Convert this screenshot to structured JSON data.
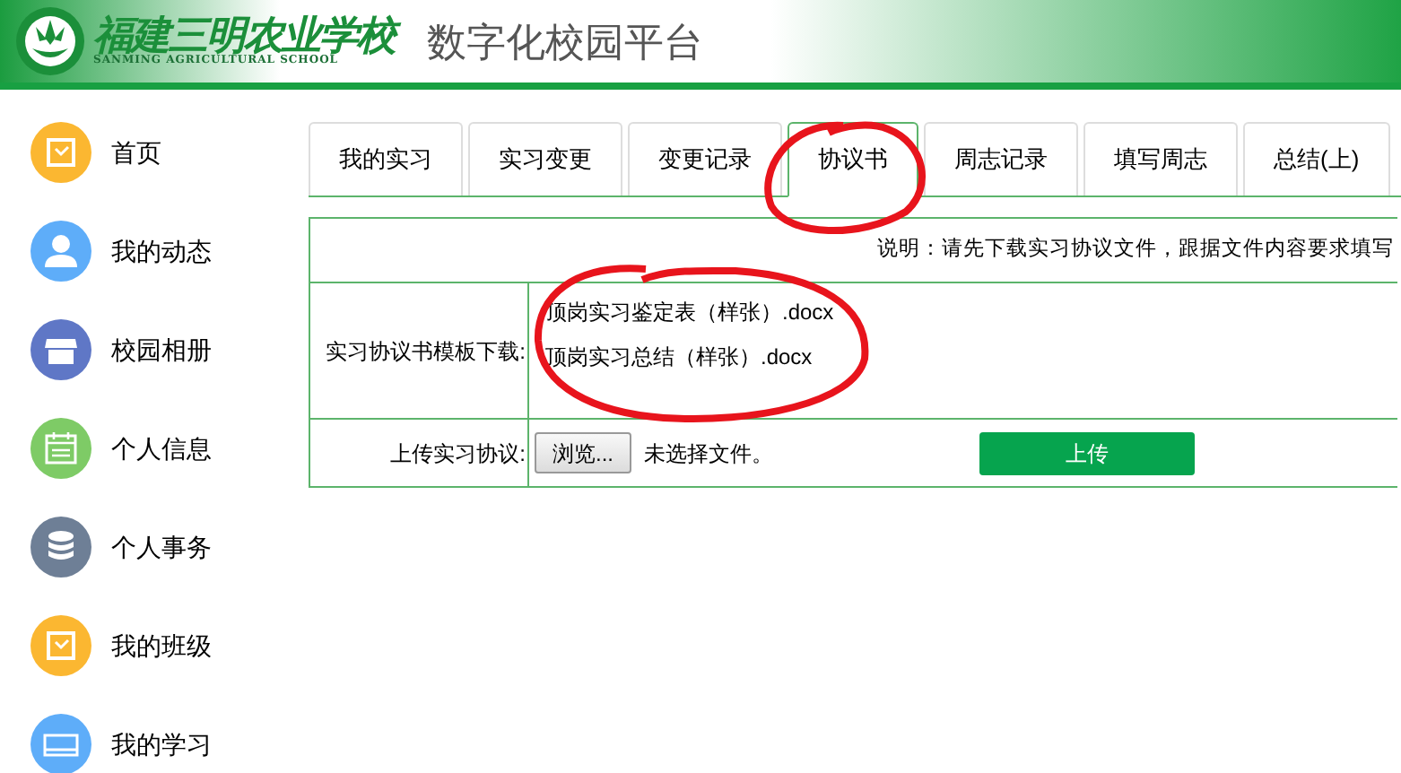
{
  "header": {
    "school_name": "福建三明农业学校",
    "school_name_en": "SANMING AGRICULTURAL SCHOOL",
    "platform_title": "数字化校园平台"
  },
  "sidebar": {
    "items": [
      {
        "label": "首页",
        "kind": "checkbox",
        "color": "#fbb731"
      },
      {
        "label": "我的动态",
        "kind": "person",
        "color": "#5eadf9"
      },
      {
        "label": "校园相册",
        "kind": "store",
        "color": "#5f77c6"
      },
      {
        "label": "个人信息",
        "kind": "calendar",
        "color": "#7ecb66"
      },
      {
        "label": "个人事务",
        "kind": "database",
        "color": "#6e7f96"
      },
      {
        "label": "我的班级",
        "kind": "checkbox",
        "color": "#fbb731"
      },
      {
        "label": "我的学习",
        "kind": "card",
        "color": "#5eadf9"
      }
    ]
  },
  "tabs": [
    {
      "label": "我的实习",
      "selected": false
    },
    {
      "label": "实习变更",
      "selected": false
    },
    {
      "label": "变更记录",
      "selected": false
    },
    {
      "label": "协议书",
      "selected": true
    },
    {
      "label": "周志记录",
      "selected": false
    },
    {
      "label": "填写周志",
      "selected": false
    },
    {
      "label": "总结(上)",
      "selected": false
    }
  ],
  "note": "说明：请先下载实习协议文件，跟据文件内容要求填写",
  "download": {
    "label": "实习协议书模板下载:",
    "files": [
      "顶岗实习鉴定表（样张）.docx",
      "顶岗实习总结（样张）.docx"
    ]
  },
  "upload": {
    "label": "上传实习协议:",
    "browse_button": "浏览...",
    "file_status": "未选择文件。",
    "upload_button": "上传"
  }
}
